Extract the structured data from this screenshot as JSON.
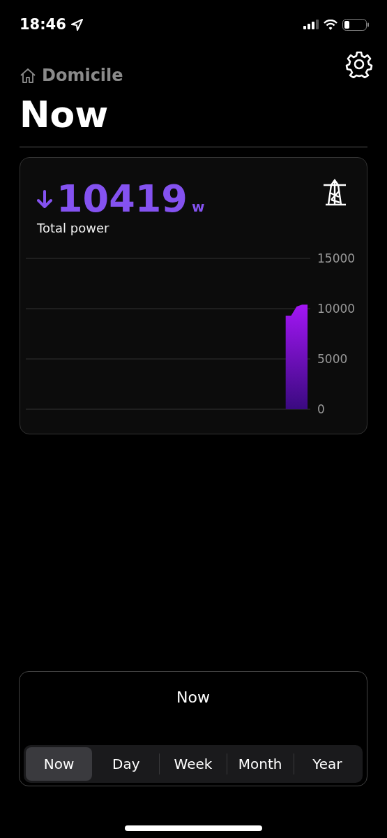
{
  "status_bar": {
    "time": "18:46"
  },
  "header": {
    "breadcrumb": "Domicile",
    "title": "Now"
  },
  "power_card": {
    "value": "10419",
    "unit": "w",
    "label": "Total power",
    "chart_data": {
      "type": "area",
      "ylim": [
        0,
        15000
      ],
      "yticks": [
        0,
        5000,
        10000,
        15000
      ],
      "values": [
        null,
        null,
        null,
        null,
        null,
        null,
        null,
        null,
        null,
        null,
        null,
        null,
        null,
        null,
        null,
        null,
        null,
        null,
        null,
        null,
        null,
        null,
        null,
        null,
        null,
        null,
        null,
        null,
        null,
        null,
        null,
        null,
        null,
        null,
        null,
        null,
        null,
        null,
        null,
        null,
        null,
        null,
        null,
        null,
        null,
        null,
        null,
        9300,
        9300,
        10200,
        10400,
        10400
      ]
    }
  },
  "period_panel": {
    "title": "Now",
    "tabs": [
      {
        "label": "Now",
        "selected": true
      },
      {
        "label": "Day",
        "selected": false
      },
      {
        "label": "Week",
        "selected": false
      },
      {
        "label": "Month",
        "selected": false
      },
      {
        "label": "Year",
        "selected": false
      }
    ]
  }
}
